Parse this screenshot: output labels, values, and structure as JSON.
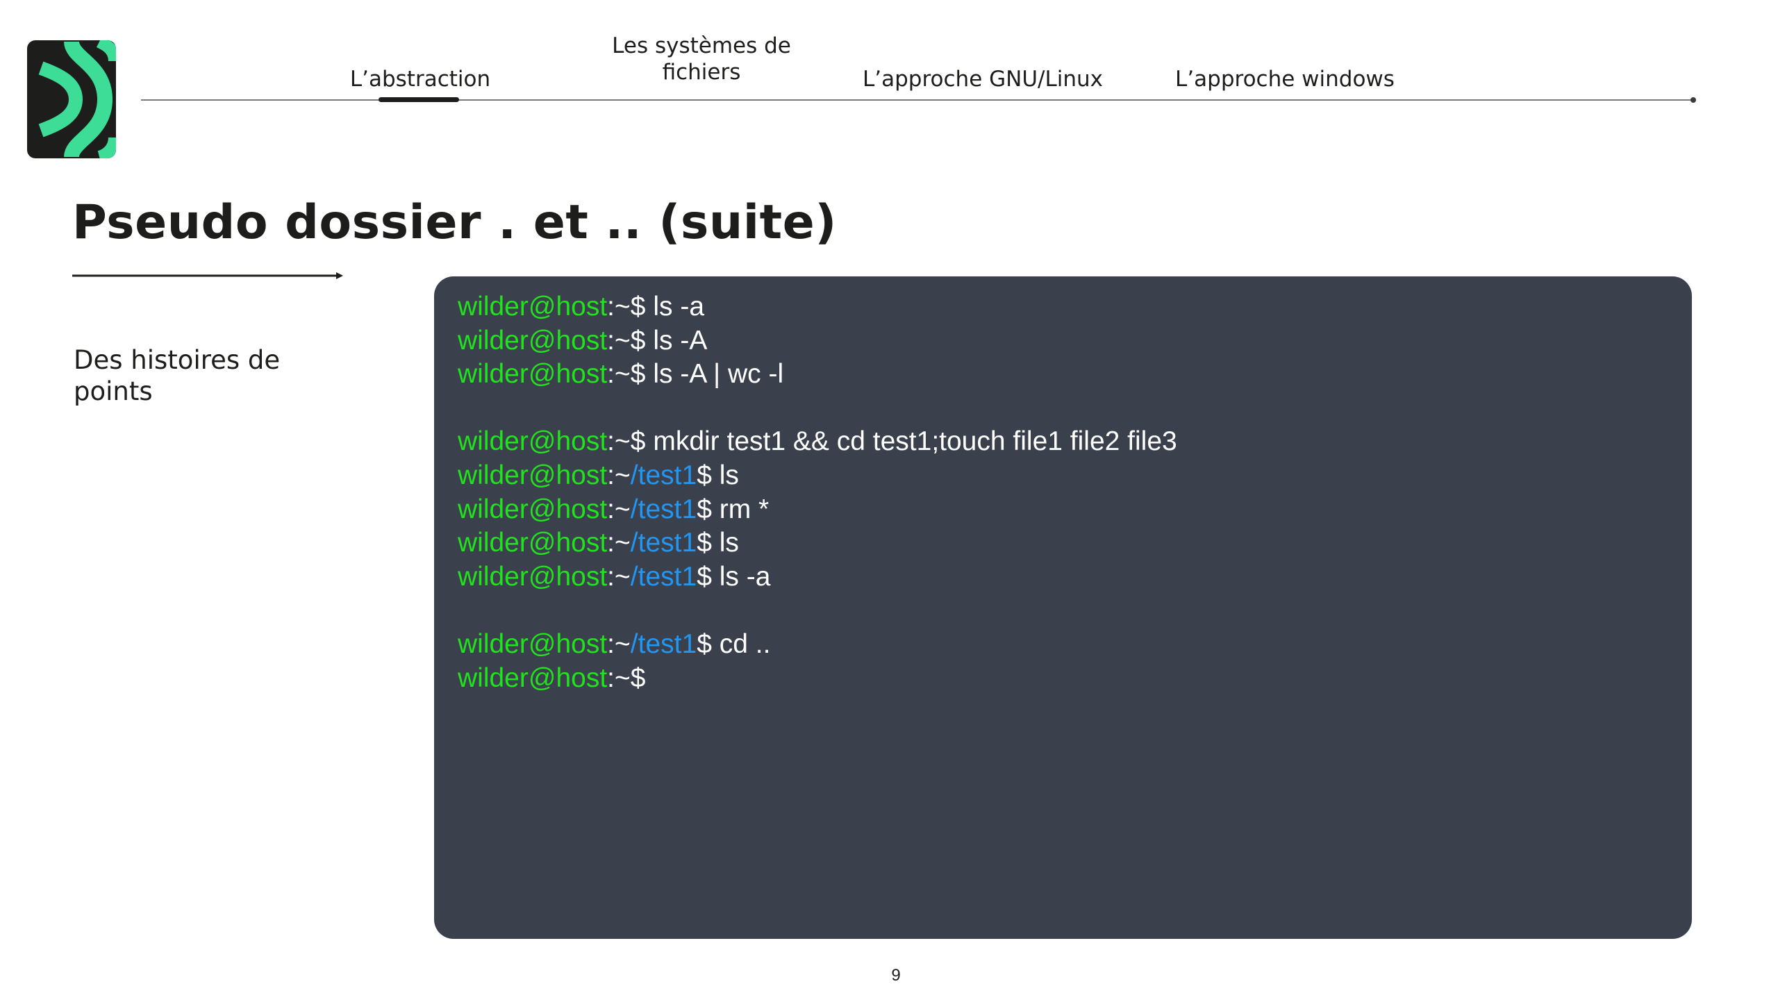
{
  "nav": {
    "items": [
      {
        "label": "L’abstraction",
        "active": true
      },
      {
        "label": "Les systèmes de fichiers",
        "active": false
      },
      {
        "label": "L’approche GNU/Linux",
        "active": false
      },
      {
        "label": "L’approche windows",
        "active": false
      }
    ]
  },
  "title": "Pseudo dossier . et .. (suite)",
  "side_text": "Des histoires de points",
  "terminal": {
    "colors": {
      "background": "#3b404d",
      "user": "#22e11e",
      "path": "#2196f3",
      "text": "#ffffff"
    },
    "user": "wilder@host",
    "lines": [
      {
        "path": "",
        "cmd": "ls -a"
      },
      {
        "path": "",
        "cmd": "ls -A"
      },
      {
        "path": "",
        "cmd": "ls -A | wc -l"
      },
      null,
      {
        "path": "",
        "cmd": "mkdir test1 && cd test1;touch file1 file2 file3"
      },
      {
        "path": "/test1",
        "cmd": "ls"
      },
      {
        "path": "/test1",
        "cmd": "rm *"
      },
      {
        "path": "/test1",
        "cmd": "ls"
      },
      {
        "path": "/test1",
        "cmd": "ls -a"
      },
      null,
      {
        "path": "/test1",
        "cmd": "cd .."
      },
      {
        "path": "",
        "cmd": ""
      }
    ]
  },
  "page_number": "9",
  "logo": {
    "icon": "chevron-logo-icon",
    "colors": {
      "background": "#1d1d1b",
      "accent": "#3ddc97"
    }
  }
}
